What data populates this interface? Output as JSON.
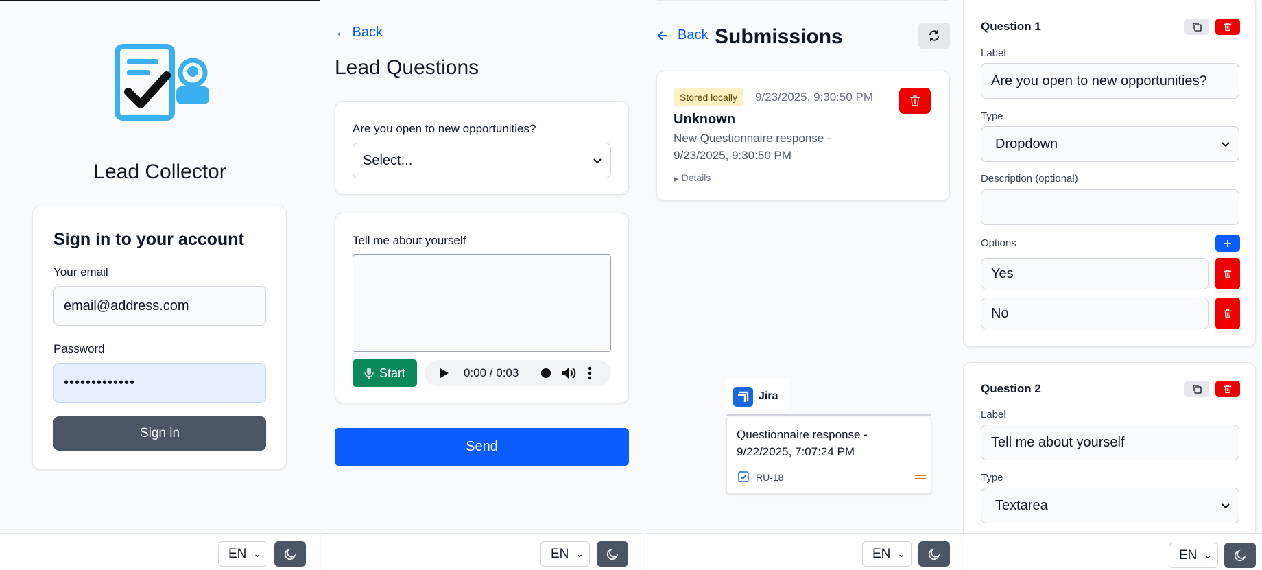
{
  "footer": {
    "language": "EN"
  },
  "login": {
    "app_title": "Lead Collector",
    "heading": "Sign in to your account",
    "email_label": "Your email",
    "email_value": "email@address.com",
    "password_label": "Password",
    "password_value": "•••••••••••••",
    "signin_label": "Sign in"
  },
  "questions_page": {
    "back_label": "← Back",
    "title": "Lead Questions",
    "q1_label": "Are you open to new opportunities?",
    "q1_select": "Select...",
    "q2_label": "Tell me about yourself",
    "start_label": "Start",
    "audio_time": "0:00 / 0:03",
    "send_label": "Send"
  },
  "submissions": {
    "back_label": "Back",
    "title": "Submissions",
    "item": {
      "badge": "Stored locally",
      "timestamp": "9/23/2025, 9:30:50 PM",
      "name": "Unknown",
      "desc_line1": "New Questionnaire response -",
      "desc_line2": "9/23/2025, 9:30:50 PM",
      "details": "Details"
    },
    "jira": {
      "tab": "Jira",
      "title_line1": "Questionnaire response -",
      "title_line2": "9/22/2025, 7:07:24 PM",
      "key": "RU-18"
    }
  },
  "editor": {
    "q1": {
      "title": "Question 1",
      "label_caption": "Label",
      "label_value": "Are you open to new opportunities?",
      "type_caption": "Type",
      "type_value": "Dropdown",
      "desc_caption": "Description (optional)",
      "options_caption": "Options",
      "options": [
        "Yes",
        "No"
      ]
    },
    "q2": {
      "title": "Question 2",
      "label_caption": "Label",
      "label_value": "Tell me about yourself",
      "type_caption": "Type",
      "type_value": "Textarea"
    }
  },
  "colors": {
    "primary": "#0b5cff",
    "danger": "#e00000",
    "success": "#0a8a5a",
    "dark": "#4b5563"
  }
}
